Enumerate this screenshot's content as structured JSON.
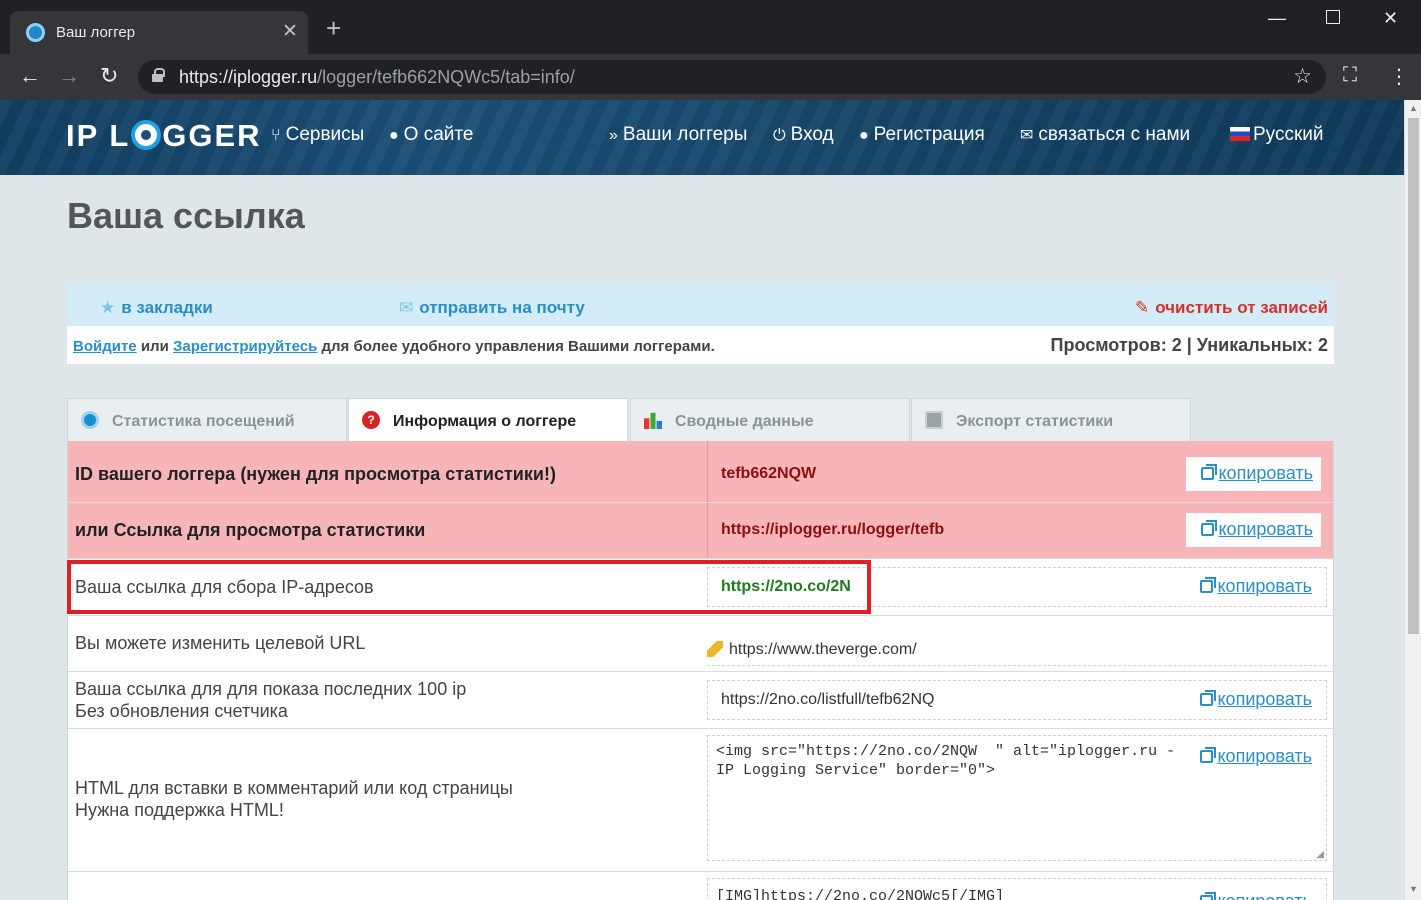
{
  "browser": {
    "tab_title": "Ваш логгер",
    "url_host": "https://iplogger.ru",
    "url_path": "/logger/tefb662NQWc5/tab=info/"
  },
  "header": {
    "logo_left": "IP L",
    "logo_right": "GGER",
    "menu": {
      "services": "Сервисы",
      "about": "О сайте",
      "your_loggers": "Ваши логгеры",
      "login": "Вход",
      "register": "Регистрация",
      "contact": "связаться с нами",
      "language": "Русский"
    }
  },
  "page": {
    "title": "Ваша ссылка",
    "actions": {
      "bookmark": "в закладки",
      "email": "отправить на почту",
      "clear": "очистить от записей"
    },
    "login_link": "Войдите",
    "or_text": " или ",
    "register_link": "Зарегистрируйтесь",
    "login_suffix": " для более удобного управления Вашими логгерами.",
    "views": "Просмотров: 2 | Уникальных: 2"
  },
  "tabs": {
    "stats": "Статистика посещений",
    "info": "Информация о логгере",
    "summary": "Сводные данные",
    "export": "Экспорт статистики"
  },
  "rows": {
    "copy_label": "копировать",
    "id_label": "ID вашего логгера (нужен для просмотра статистики!)",
    "id_value": "tefb662NQW",
    "stats_link_label": "или Ссылка для просмотра статистики",
    "stats_link_value": "https://iplogger.ru/logger/tefb",
    "collect_label": "Ваша ссылка для сбора IP-адресов",
    "collect_value": "https://2no.co/2N",
    "target_label": "Вы можете изменить целевой URL",
    "target_value": "https://www.theverge.com/",
    "last100_label_1": "Ваша ссылка для для показа последних 100 ip",
    "last100_label_2": "Без обновления счетчика",
    "last100_value": "https://2no.co/listfull/tefb62NQ",
    "html_label_1": "HTML для вставки в комментарий или код страницы",
    "html_label_2": "Нужна поддержка HTML!",
    "html_value": "<img src=\"https://2no.co/2NQW  \" alt=\"iplogger.ru - IP Logging Service\" border=\"0\">",
    "bbcode_value": "[IMG]https://2no.co/2NQWc5[/IMG]"
  },
  "colors": {
    "accent": "#2a8fc7",
    "pink_row": "#f8b5b8",
    "highlight": "#e01e25",
    "clear_red": "#d3302c"
  },
  "icons": [
    "globe-icon",
    "question-icon",
    "bar-chart-icon",
    "document-icon",
    "star-icon",
    "mail-icon",
    "eraser-icon",
    "copy-icon",
    "pencil-icon"
  ]
}
